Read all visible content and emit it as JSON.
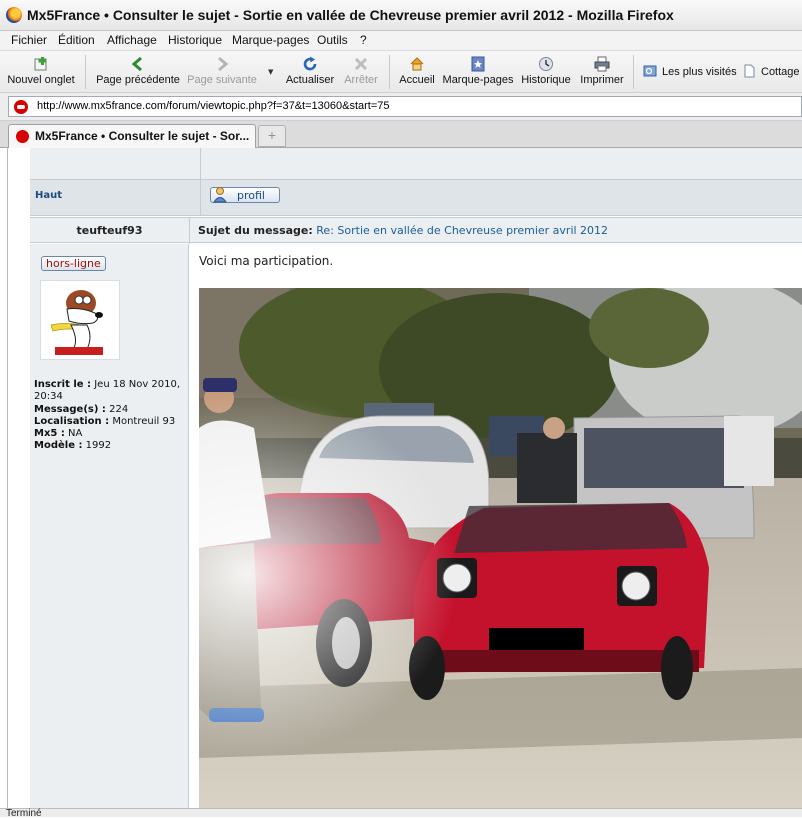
{
  "window": {
    "title": "Mx5France • Consulter le sujet - Sortie en vallée de Chevreuse premier avril 2012 - Mozilla Firefox"
  },
  "menu": [
    "Fichier",
    "Édition",
    "Affichage",
    "Historique",
    "Marque-pages",
    "Outils",
    "?"
  ],
  "toolbar": {
    "new_tab": "Nouvel onglet",
    "back": "Page précédente",
    "forward": "Page suivante",
    "reload": "Actualiser",
    "stop": "Arrêter",
    "home": "Accueil",
    "bookmarks": "Marque-pages",
    "history": "Historique",
    "print": "Imprimer",
    "most_visited": "Les plus visités",
    "cottage": "Cottage"
  },
  "address": {
    "url": "http://www.mx5france.com/forum/viewtopic.php?f=37&t=13060&start=75"
  },
  "tab": {
    "label": "Mx5France • Consulter le sujet - Sor..."
  },
  "post_nav": {
    "top_link": "Haut",
    "profile_button": "profil"
  },
  "post": {
    "author": "teufteuf93",
    "subject_label": "Sujet du message:",
    "subject": "Re: Sortie en vallée de Chevreuse premier avril 2012",
    "status": "hors-ligne",
    "info": [
      {
        "label": "Inscrit le :",
        "value": "Jeu 18 Nov 2010, 20:34"
      },
      {
        "label": "Message(s) :",
        "value": "224"
      },
      {
        "label": "Localisation :",
        "value": "Montreuil 93"
      },
      {
        "label": "Mx5 :",
        "value": "NA"
      },
      {
        "label": "Modèle :",
        "value": "1992"
      }
    ],
    "body": "Voici ma participation."
  },
  "statusbar": {
    "text": "Terminé"
  },
  "colors": {
    "link": "#1a5e96",
    "forum_bg": "#eceff2",
    "status_red": "#a01010"
  }
}
